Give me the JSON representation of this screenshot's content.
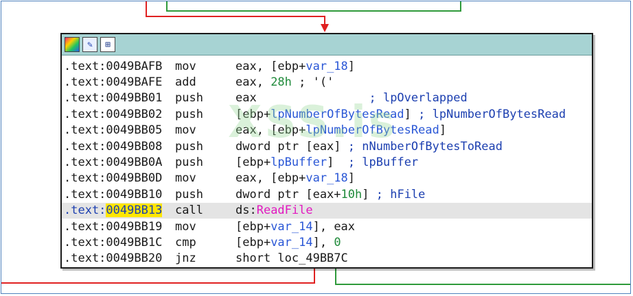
{
  "watermark": "XSS.is",
  "header_icons": [
    "color-palette-icon",
    "edit-icon",
    "graph-icon"
  ],
  "colors": {
    "header_bg": "#a7d3d3",
    "highlight_bg": "#e4e4e4",
    "address_highlight": "#ffe600",
    "edge_red": "#e02020",
    "edge_green": "#2e9a3a",
    "variable": "#2a57d6",
    "immediate": "#1f8a3a",
    "api_import": "#e218c0"
  },
  "lines": [
    {
      "seg": ".text:",
      "off": "0049BAFB",
      "mnem": "mov",
      "op1": "eax, [ebp+",
      "op1v": "var_18",
      "op1e": "]",
      "comment": ""
    },
    {
      "seg": ".text:",
      "off": "0049BAFE",
      "mnem": "add",
      "op1": "eax, ",
      "imm": "28h",
      "rest": " ; '('"
    },
    {
      "seg": ".text:",
      "off": "0049BB01",
      "mnem": "push",
      "op1": "eax",
      "cpad": "                ",
      "comment": "; lpOverlapped"
    },
    {
      "seg": ".text:",
      "off": "0049BB02",
      "mnem": "push",
      "op1": "[ebp+",
      "op1v": "lpNumberOfBytesRead",
      "op1e": "]",
      "cpad": " ",
      "comment": "; lpNumberOfBytesRead"
    },
    {
      "seg": ".text:",
      "off": "0049BB05",
      "mnem": "mov",
      "op1": "eax, [ebp+",
      "op1v": "lpNumberOfBytesRead",
      "op1e": "]"
    },
    {
      "seg": ".text:",
      "off": "0049BB08",
      "mnem": "push",
      "op1": "dword ptr [eax]",
      "cpad": " ",
      "comment": "; nNumberOfBytesToRead"
    },
    {
      "seg": ".text:",
      "off": "0049BB0A",
      "mnem": "push",
      "op1": "[ebp+",
      "op1v": "lpBuffer",
      "op1e": "]",
      "cpad": "  ",
      "comment": "; lpBuffer"
    },
    {
      "seg": ".text:",
      "off": "0049BB0D",
      "mnem": "mov",
      "op1": "eax, [ebp+",
      "op1v": "var_18",
      "op1e": "]"
    },
    {
      "seg": ".text:",
      "off": "0049BB10",
      "mnem": "push",
      "op1": "dword ptr [eax+",
      "imm": "10h",
      "rest": "]",
      "cpad": " ",
      "comment": "; hFile"
    },
    {
      "seg": ".text:",
      "off": "0049BB13",
      "mnem": "call",
      "op1": "ds:",
      "api": "ReadFile"
    },
    {
      "seg": ".text:",
      "off": "0049BB19",
      "mnem": "mov",
      "op1": "[ebp+",
      "op1v": "var_14",
      "op1e": "], eax"
    },
    {
      "seg": ".text:",
      "off": "0049BB1C",
      "mnem": "cmp",
      "op1": "[ebp+",
      "op1v": "var_14",
      "op1e": "], ",
      "imm": "0"
    },
    {
      "seg": ".text:",
      "off": "0049BB20",
      "mnem": "jnz",
      "op1": "short loc_49BB7C"
    }
  ]
}
